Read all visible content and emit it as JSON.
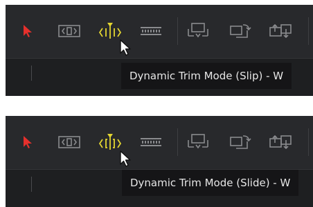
{
  "panels": [
    {
      "tooltip": "Dynamic Trim Mode (Slip) - W",
      "active_tool": "dynamic-trim-slip"
    },
    {
      "tooltip": "Dynamic Trim Mode (Slide) - W",
      "active_tool": "dynamic-trim-slide"
    }
  ],
  "colors": {
    "panel_bg": "#28292c",
    "track_bg": "#1e1f21",
    "selection_red": "#e5302c",
    "active_yellow": "#e3d531",
    "icon_gray": "#8a8b8e",
    "tooltip_bg": "#151517",
    "tooltip_text": "#e6e6e6"
  },
  "icons": [
    "selection-arrow-icon",
    "trim-edit-icon",
    "dynamic-trim-icon",
    "blade-icon",
    "insert-clip-icon",
    "overwrite-clip-icon",
    "replace-clip-icon"
  ]
}
